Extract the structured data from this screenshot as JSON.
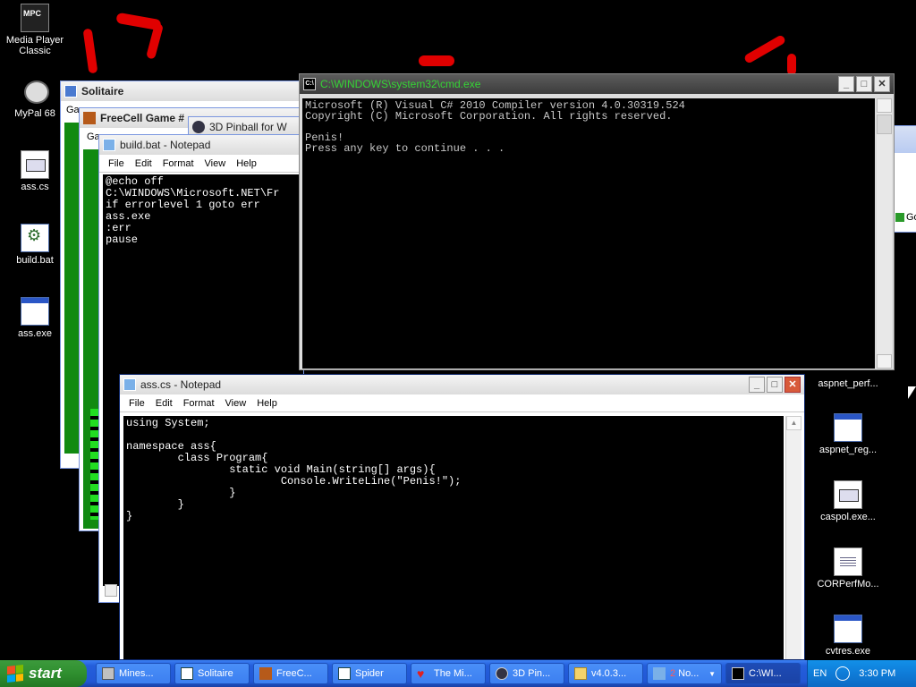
{
  "desktop": {
    "left_icons": [
      {
        "label": "Media Player Classic",
        "icon": "media-player-classic-icon"
      },
      {
        "label": "MyPal 68",
        "icon": "mypal-icon"
      },
      {
        "label": "ass.cs",
        "icon": "cs-file-icon"
      },
      {
        "label": "build.bat",
        "icon": "batch-file-icon"
      },
      {
        "label": "ass.exe",
        "icon": "exe-file-icon"
      }
    ],
    "right_icons": [
      {
        "label": "aspnet_perf...",
        "icon": "exe-file-icon"
      },
      {
        "label": "aspnet_reg...",
        "icon": "exe-file-icon"
      },
      {
        "label": "caspol.exe...",
        "icon": "cs-file-icon"
      },
      {
        "label": "CORPerfMo...",
        "icon": "text-file-icon"
      },
      {
        "label": "cvtres.exe",
        "icon": "exe-file-icon"
      }
    ]
  },
  "windows": {
    "solitaire": {
      "title": "Solitaire",
      "menu_stub": "Ga"
    },
    "freecell": {
      "title": "FreeCell Game #",
      "menu_stub": "Ga"
    },
    "pinball": {
      "title": "3D Pinball for W"
    },
    "build_bat": {
      "title": "build.bat - Notepad",
      "menu": [
        "File",
        "Edit",
        "Format",
        "View",
        "Help"
      ],
      "content": "@echo off\nC:\\WINDOWS\\Microsoft.NET\\Fr\nif errorlevel 1 goto err\nass.exe\n:err\npause"
    },
    "cmd": {
      "title": "C:\\WINDOWS\\system32\\cmd.exe",
      "content": "Microsoft (R) Visual C# 2010 Compiler version 4.0.30319.524\nCopyright (C) Microsoft Corporation. All rights reserved.\n\nPenis!\nPress any key to continue . . ."
    },
    "ass_cs": {
      "title": "ass.cs - Notepad",
      "menu": [
        "File",
        "Edit",
        "Format",
        "View",
        "Help"
      ],
      "content": "using System;\n\nnamespace ass{\n        class Program{\n                static void Main(string[] args){\n                        Console.WriteLine(\"Penis!\");\n                }\n        }\n}"
    },
    "explorer_stub": {
      "go_label": "Go"
    }
  },
  "taskbar": {
    "start_label": "start",
    "buttons": [
      {
        "label": "Mines...",
        "icon": "minesweeper-icon",
        "active": false
      },
      {
        "label": "Solitaire",
        "icon": "solitaire-icon",
        "active": false
      },
      {
        "label": "FreeC...",
        "icon": "freecell-icon",
        "active": false
      },
      {
        "label": "Spider",
        "icon": "spider-icon",
        "active": false
      },
      {
        "label": "The Mi...",
        "icon": "hearts-icon",
        "active": false
      },
      {
        "label": "3D Pin...",
        "icon": "pinball-icon",
        "active": false
      },
      {
        "label": "v4.0.3...",
        "icon": "folder-icon",
        "active": false
      },
      {
        "label": "No...",
        "icon": "notepad-icon",
        "active": false,
        "count": "2"
      },
      {
        "label": "C:\\WI...",
        "icon": "cmd-icon",
        "active": true
      }
    ],
    "tray": {
      "language": "EN",
      "time": "3:30 PM"
    }
  }
}
